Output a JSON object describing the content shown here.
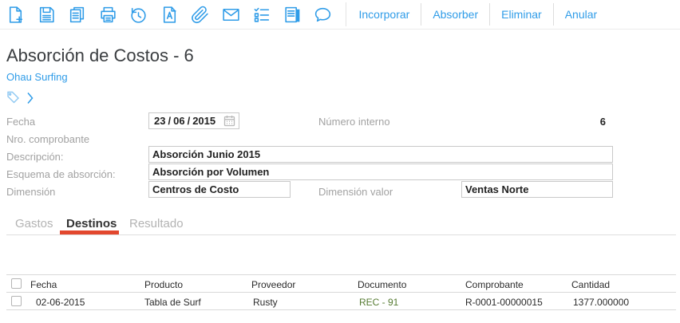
{
  "toolbar": {
    "icons": [
      "new-document-icon",
      "save-icon",
      "copy-icon",
      "print-icon",
      "history-icon",
      "font-document-icon",
      "attachment-icon",
      "mail-icon",
      "checklist-icon",
      "journal-icon",
      "comment-icon"
    ],
    "buttons": [
      {
        "label": "Incorporar"
      },
      {
        "label": "Absorber"
      },
      {
        "label": "Eliminar"
      },
      {
        "label": "Anular"
      }
    ]
  },
  "header": {
    "title": "Absorción de Costos - 6",
    "subtitle_link": "Ohau Surfing"
  },
  "form": {
    "fecha_label": "Fecha",
    "fecha_day": "23",
    "fecha_separator": "/",
    "fecha_month": "06",
    "fecha_year": "2015",
    "numero_interno_label": "Número interno",
    "numero_interno_value": "6",
    "nro_comprobante_label": "Nro. comprobante",
    "descripcion_label": "Descripción:",
    "descripcion_value": "Absorción Junio 2015",
    "esquema_label": "Esquema de absorción:",
    "esquema_value": "Absorción por Volumen",
    "dimension_label": "Dimensión",
    "dimension_value": "Centros de Costo",
    "dimension_valor_label": "Dimensión valor",
    "dimension_valor_value": "Ventas Norte"
  },
  "tabs": [
    {
      "label": "Gastos",
      "active": false
    },
    {
      "label": "Destinos",
      "active": true
    },
    {
      "label": "Resultado",
      "active": false
    }
  ],
  "table": {
    "headers": [
      "Fecha",
      "Producto",
      "Proveedor",
      "Documento",
      "Comprobante",
      "Cantidad"
    ],
    "rows": [
      {
        "fecha": "02-06-2015",
        "producto": "Tabla de Surf",
        "proveedor": "Rusty",
        "documento": "REC - 91",
        "comprobante": "R-0001-00000015",
        "cantidad": "1377.000000"
      }
    ]
  },
  "colors": {
    "accent_blue": "#2f9ce8",
    "active_tab_underline": "#e2472e",
    "document_link_green": "#567b32",
    "label_gray": "#a2a2a2"
  }
}
